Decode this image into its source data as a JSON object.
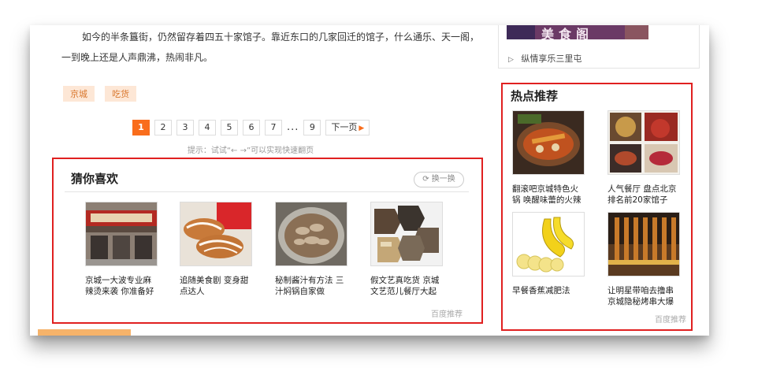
{
  "article": {
    "paragraph": "如今的半条簋街，仍然留存着四五十家馆子。靠近东口的几家回迁的馆子，什么通乐、天一阁，一到晚上还是人声鼎沸，热闹非凡。"
  },
  "tags": [
    "京城",
    "吃货"
  ],
  "pagination": {
    "pages": [
      "1",
      "2",
      "3",
      "4",
      "5",
      "6",
      "7"
    ],
    "ellipsis": "...",
    "last": "9",
    "next": "下一页",
    "active": "1",
    "hint": "提示：试试“← →”可以实现快速翻页"
  },
  "guess": {
    "title": "猜你喜欢",
    "swap": "换一换",
    "items": [
      {
        "caption": "京城一大波专业麻辣烫来袭 你准备好"
      },
      {
        "caption": "追随美食剧 变身甜点达人"
      },
      {
        "caption": "秘制酱汁有方法 三汁焖锅自家做"
      },
      {
        "caption": "假文艺真吃货 京城文艺范儿餐厅大起"
      }
    ],
    "source": "百度推荐"
  },
  "sidebar": {
    "banner_text": "美食阁",
    "link": "纵情享乐三里屯",
    "hot": {
      "title": "热点推荐",
      "items": [
        {
          "caption": "翻滚吧京城特色火锅 唤醒味蕾的火辣"
        },
        {
          "caption": "人气餐厅 盘点北京排名前20家馆子"
        },
        {
          "caption": "早餐香蕉减肥法"
        },
        {
          "caption": "让明星带咱去撸串 京城隐秘烤串大爆"
        }
      ],
      "source": "百度推荐"
    }
  },
  "colors": {
    "accent": "#f96d1c",
    "highlight_border": "#e02020",
    "tag_bg": "#fde7d6"
  }
}
